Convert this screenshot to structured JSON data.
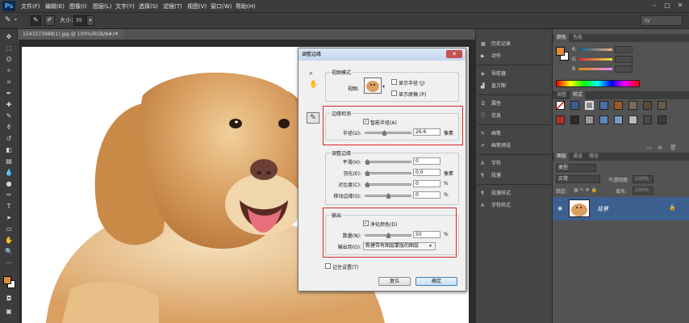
{
  "menubar": {
    "logo": "Ps",
    "items": [
      "文件(F)",
      "编辑(E)",
      "图像(I)",
      "图层(L)",
      "文字(Y)",
      "选择(S)",
      "滤镜(T)",
      "视图(V)",
      "窗口(W)",
      "帮助(H)"
    ]
  },
  "options": {
    "size_label": "大小：",
    "size_value": "35",
    "workspace": "zy"
  },
  "document": {
    "tab_title": "1543373988(1).jpg @ 100%(RGB/8#) *",
    "close": "×"
  },
  "dialog": {
    "title": "调整边缘",
    "close": "✕",
    "view_mode": {
      "legend": "视图模式",
      "view_label": "视图:",
      "show_radius": "显示半径 (J)",
      "show_original": "显示原稿 (P)"
    },
    "edge_detection": {
      "legend": "边缘检测",
      "smart_radius": "智能半径(A)",
      "radius_label": "半径(U):",
      "radius_value": "26.6",
      "radius_unit": "像素",
      "radius_fraction": 0.42
    },
    "adjust_edge": {
      "legend": "调整边缘",
      "rows": [
        {
          "label": "平滑(H):",
          "value": "0",
          "unit": "",
          "fraction": 0.0
        },
        {
          "label": "羽化(E):",
          "value": "0.0",
          "unit": "像素",
          "fraction": 0.0
        },
        {
          "label": "对比度(C):",
          "value": "0",
          "unit": "%",
          "fraction": 0.0
        },
        {
          "label": "移动边缘(S):",
          "value": "0",
          "unit": "%",
          "fraction": 0.5
        }
      ]
    },
    "output": {
      "legend": "输出",
      "decontaminate": "净化颜色(D)",
      "amount_label": "数量(N):",
      "amount_value": "50",
      "amount_unit": "%",
      "amount_fraction": 0.5,
      "output_to_label": "输出到(O):",
      "output_to_value": "新建带有图层蒙版的图层"
    },
    "remember": "记住设置(T)",
    "reset": "复位",
    "ok": "确定"
  },
  "panel_strip": {
    "items": [
      "历史记录",
      "动作",
      "导航器",
      "直方图",
      "属性",
      "信息",
      "画笔",
      "画笔预设",
      "字符",
      "段落",
      "段落样式",
      "字符样式"
    ]
  },
  "color_panel": {
    "tabs": [
      "颜色",
      "色板"
    ],
    "r": "R",
    "g": "G",
    "b": "B",
    "r_value": "",
    "g_value": "",
    "b_value": ""
  },
  "adjust_panel": {
    "tabs": [
      "调整",
      "样式"
    ]
  },
  "layers_panel": {
    "tabs": [
      "图层",
      "通道",
      "路径"
    ],
    "kind": "类型",
    "blend": "正常",
    "opacity_label": "不透明度:",
    "opacity_value": "100%",
    "lock_label": "锁定:",
    "fill_label": "填充:",
    "fill_value": "100%",
    "layer_name": "背景"
  },
  "colors": {
    "foreground": "#e08a3c",
    "background": "#ffffff",
    "highlight_red": "#d9282a",
    "accent_blue": "#3b5f8f"
  }
}
